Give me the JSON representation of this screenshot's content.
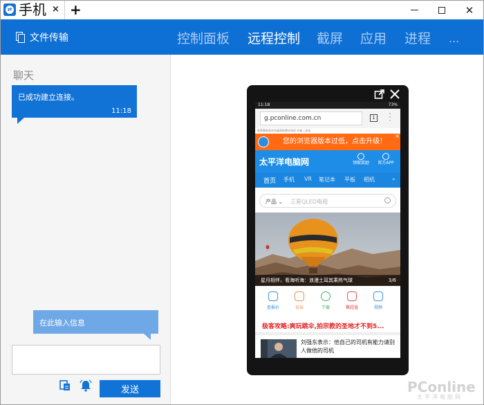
{
  "window": {
    "tab_title": "手机",
    "tab_close": "×",
    "new_tab": "+",
    "min_glyph": "",
    "close_glyph": "✕"
  },
  "toolbar": {
    "file_transfer": "文件传输",
    "tabs": [
      "控制面板",
      "远程控制",
      "截屏",
      "应用",
      "进程",
      "..."
    ],
    "active_tab": "远程控制"
  },
  "chat": {
    "title": "聊天",
    "messages": [
      {
        "text": "已成功建立连接。",
        "time": "11:18"
      }
    ],
    "input_hint": "在此输入信息",
    "input_value": "",
    "send_label": "发送"
  },
  "phone": {
    "status_time": "11:18",
    "status_right": "73%",
    "url": "g.pconline.com.cn",
    "tab_count": "1",
    "tiny_line": "推荐最新版浏览器获取更好体验 升级 | 关闭",
    "banner_text": "您的浏览器版本过低，点击升级！",
    "banner_close": "×",
    "site_logo": "太平洋电脑网",
    "site_actions": [
      "领取奖励",
      "官方APP"
    ],
    "categories": [
      "首页",
      "手机",
      "VR",
      "笔记本",
      "平板",
      "相机"
    ],
    "active_category": "首页",
    "search_kind": "产品 ⌄",
    "search_placeholder": "三星QLED电视",
    "hero_caption": "星月相伴，看海听海：浪漫土耳其乘热气球",
    "hero_counter": "3/6",
    "quick_links": [
      "查报价",
      "论坛",
      "下载",
      "聚超值",
      "视频"
    ],
    "headline": "极客攻略:爽玩跳伞,拍宗教的圣地才不到5...",
    "news_title": "刘强东表示：他自己的司机有能力请别人做他的司机"
  },
  "watermark": {
    "brand": "PConline",
    "sub": "太平洋电脑网"
  },
  "colors": {
    "brand_blue": "#0e6fd4",
    "bubble_blue": "#1273d6",
    "hint_blue": "#6fa8e6",
    "banner_orange": "#ff6a13",
    "headline_red": "#e52222"
  },
  "icons": [
    "teamviewer-logo-icon",
    "file-transfer-icon",
    "chat-screenshot-icon",
    "chat-notify-icon",
    "popout-icon",
    "close-icon",
    "search-icon"
  ]
}
